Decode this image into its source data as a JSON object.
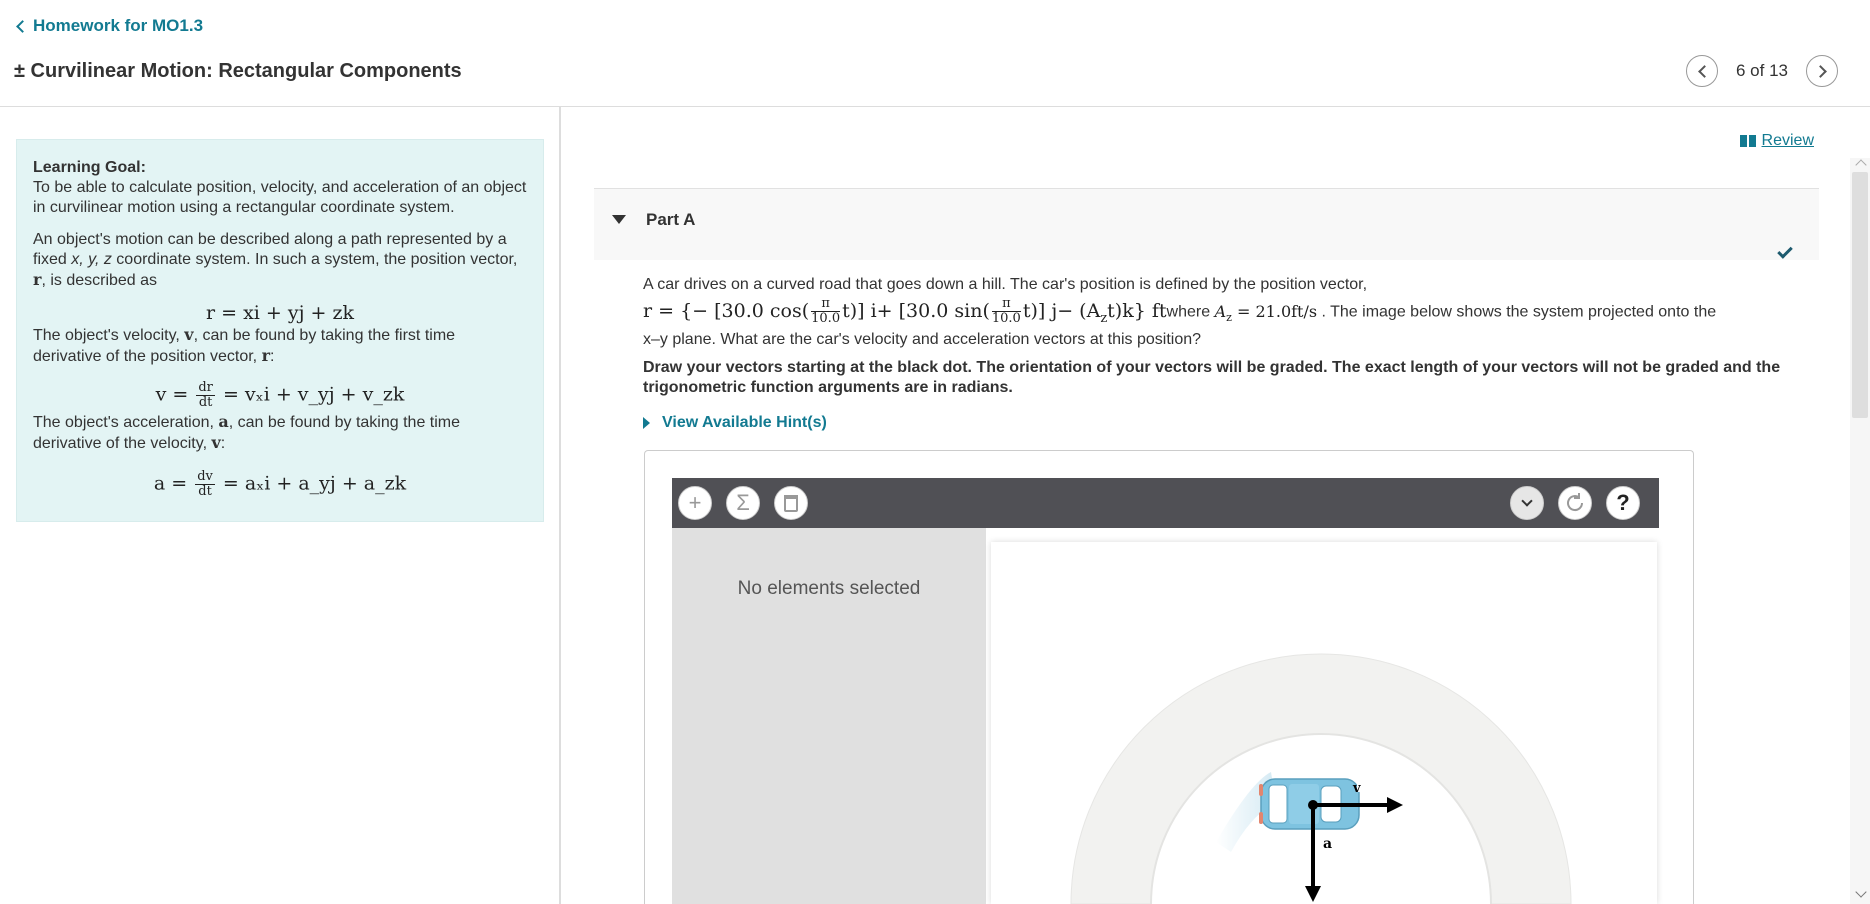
{
  "header": {
    "back_label": "Homework for MO1.3",
    "title": "± Curvilinear Motion: Rectangular Components",
    "pager_text": "6 of 13"
  },
  "goal": {
    "title": "Learning Goal:",
    "intro": "To be able to calculate position, velocity, and acceleration of an object in curvilinear motion using a rectangular coordinate system.",
    "p1_a": "An object's motion can be described along a path represented by a fixed ",
    "p1_xyz": "x, y, z",
    "p1_b": " coordinate system.  In such a system, the position vector, ",
    "p1_r": "r",
    "p1_c": ", is described as",
    "eq_r": "r = xi + yj + zk",
    "p2_a": "The object's velocity, ",
    "p2_v": "v",
    "p2_b": ", can be found by taking the first time derivative of the position vector, ",
    "p2_r": "r",
    "p2_c": ":",
    "eq_v_lhs": "v =",
    "eq_v_num": "dr",
    "eq_v_den": "dt",
    "eq_v_rhs": "= vₓi + v_yj + v_zk",
    "p3_a": "The object's acceleration, ",
    "p3_a_sym": "a",
    "p3_b": ", can be found by taking the time derivative of the velocity, ",
    "p3_v": "v",
    "p3_c": ":",
    "eq_a_lhs": "a =",
    "eq_a_num": "dv",
    "eq_a_den": "dt",
    "eq_a_rhs": "= aₓi + a_yj + a_zk"
  },
  "review_label": " Review",
  "part": {
    "title": "Part A"
  },
  "question": {
    "line1": "A car drives on a curved road that goes down a hill.  The car's position is defined by the position vector,",
    "eq_pre": "r = {− [30.0 cos(",
    "eq_frac1_num": "π",
    "eq_frac1_den": "10.0",
    "eq_mid1": "t)] i+ [30.0 sin(",
    "eq_frac2_num": "π",
    "eq_frac2_den": "10.0",
    "eq_mid2": "t)] j− (A",
    "eq_sub_z": "z",
    "eq_end": "t)k} ft",
    "where": "where ",
    "az_eq": "A",
    "az_sub": "z",
    "az_val": " = 21.0ft/s",
    "line2_tail": " . The image below shows the system projected onto the",
    "line3": "x–y plane. What are the car's velocity and acceleration vectors at this position?",
    "instructions": "Draw your vectors starting at the black dot. The orientation of your vectors will be graded. The exact length of your vectors will not be graded and the trigonometric function arguments are in radians."
  },
  "hint_label": "View Available Hint(s)",
  "tool": {
    "no_selection": "No elements selected",
    "add_icon": "+",
    "sigma_icon": "Σ",
    "help_icon": "?",
    "vector_label_a": "a",
    "vector_label_v": "v"
  },
  "colors": {
    "accent": "#127a91",
    "panel_bg": "#e3f4f4",
    "toolbar_bg": "#505055",
    "car_blue": "#7ec3e0"
  }
}
